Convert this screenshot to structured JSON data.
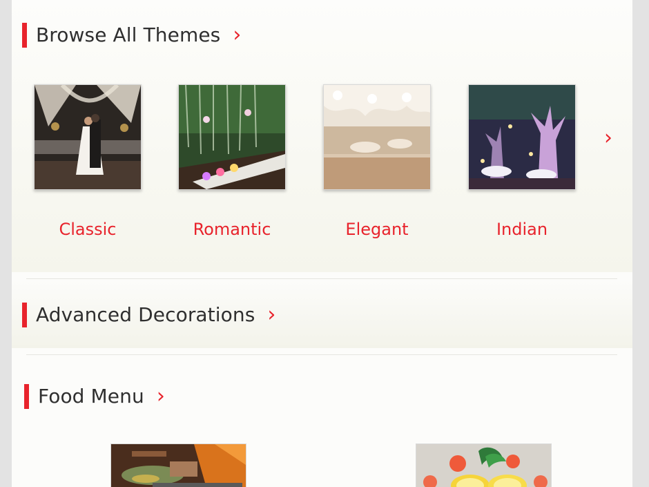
{
  "sections": {
    "themes": {
      "title": "Browse All Themes",
      "items": [
        {
          "label": "Classic",
          "icon": "classic-wedding-photo"
        },
        {
          "label": "Romantic",
          "icon": "romantic-garden-photo"
        },
        {
          "label": "Elegant",
          "icon": "elegant-hall-photo"
        },
        {
          "label": "Indian",
          "icon": "indian-night-photo"
        }
      ]
    },
    "advanced": {
      "title": "Advanced Decorations"
    },
    "food": {
      "title": "Food Menu",
      "items": [
        {
          "icon": "buffet-food-photo"
        },
        {
          "icon": "seafood-platter-photo"
        }
      ]
    }
  },
  "colors": {
    "accent": "#e8232c",
    "title": "#2f2f2f"
  },
  "icons": {
    "more": "chevron-right-icon"
  }
}
